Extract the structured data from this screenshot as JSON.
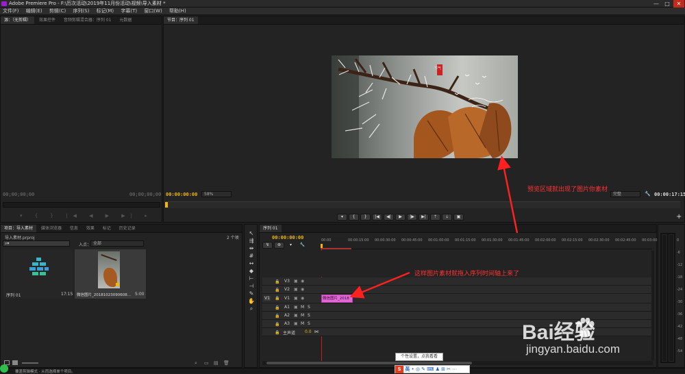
{
  "window": {
    "title": "Adobe Premiere Pro - F:\\历次活动\\2019年11月份活动\\视频\\导入素材 *",
    "controls": [
      "—",
      "□",
      "✕"
    ]
  },
  "menu": [
    "文件(F)",
    "编辑(E)",
    "剪辑(C)",
    "序列(S)",
    "标记(M)",
    "字幕(T)",
    "窗口(W)",
    "帮助(H)"
  ],
  "source_panel": {
    "tabs": [
      "源：（无剪辑）",
      "效果控件",
      "音频剪辑混合器：序列 01",
      "元数据"
    ],
    "timecode_left": "00;00;00;00",
    "timecode_right": "00;00;00;00"
  },
  "program_panel": {
    "tab": "节目：序列 01",
    "timecode": "00:00:00:00",
    "zoom": "58%",
    "quality": "完整",
    "duration": "00:00:17:15",
    "annotation": "预览区域就出现了图片你素材",
    "image_text": "节气"
  },
  "project_panel": {
    "tabs": [
      "项目：导入素材",
      "媒体浏览器",
      "信息",
      "效果",
      "标记",
      "历史记录"
    ],
    "file": "导入素材.prproj",
    "count": "2 个项",
    "in_label": "入点：",
    "in_value": "全部",
    "items": [
      {
        "name": "序列 01",
        "duration": "17:15"
      },
      {
        "name": "微信图片_20181023090608...",
        "duration": "5:00"
      }
    ]
  },
  "timeline": {
    "tab": "序列 01",
    "timecode": "00:00:00:00",
    "ruler": [
      "00:00",
      "00:00:15:00",
      "00:00:30:00",
      "00:00:45:00",
      "00:01:00:00",
      "00:01:15:00",
      "00:01:30:00",
      "00:01:45:00",
      "00:02:00:00",
      "00:02:15:00",
      "00:02:30:00",
      "00:02:45:00",
      "00:03:00:0"
    ],
    "video_tracks": [
      "V3",
      "V2",
      "V1"
    ],
    "audio_tracks": [
      "A1",
      "A2",
      "A3"
    ],
    "master_label": "主声道",
    "master_value": "0.0",
    "track_selector": "V1",
    "clip_label": "微信图片_2018",
    "annotation": "这样图片素材就拖入序列时间轴上来了"
  },
  "meter_scale": [
    "0",
    "-6",
    "-12",
    "-18",
    "-24",
    "-30",
    "-36",
    "-42",
    "-48",
    "-54"
  ],
  "status": {
    "text": "覆盖剪辑模式 · 从而选择单个项目。"
  },
  "ime": {
    "tooltip": "个性设置，点我看看",
    "lang": "英"
  },
  "watermark": {
    "brand": "Bai经验",
    "url": "jingyan.baidu.com"
  }
}
